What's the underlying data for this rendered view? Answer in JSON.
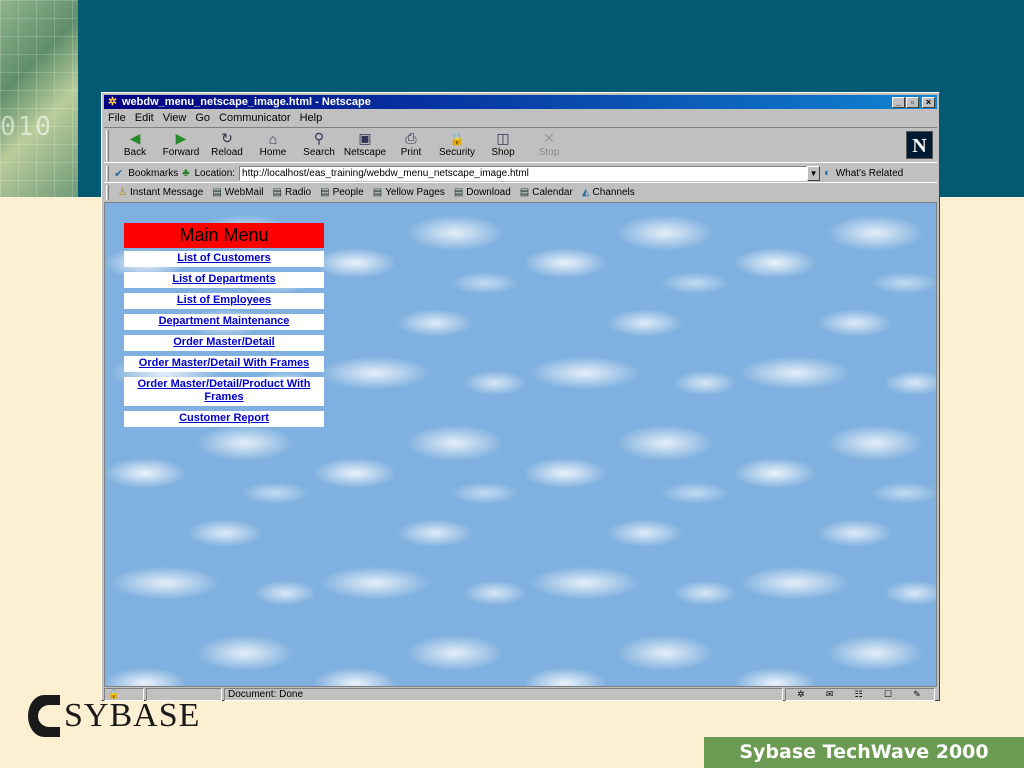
{
  "window": {
    "title": "webdw_menu_netscape_image.html - Netscape",
    "controls": {
      "minimize": "_",
      "maximize": "▫",
      "close": "×"
    }
  },
  "menubar": [
    "File",
    "Edit",
    "View",
    "Go",
    "Communicator",
    "Help"
  ],
  "navigation_toolbar": [
    {
      "label": "Back",
      "icon": "back-arrow-icon",
      "glyph": "◀",
      "enabled": true
    },
    {
      "label": "Forward",
      "icon": "forward-arrow-icon",
      "glyph": "▶",
      "enabled": true
    },
    {
      "label": "Reload",
      "icon": "reload-icon",
      "glyph": "↻",
      "enabled": true
    },
    {
      "label": "Home",
      "icon": "home-icon",
      "glyph": "⌂",
      "enabled": true
    },
    {
      "label": "Search",
      "icon": "search-icon",
      "glyph": "⚲",
      "enabled": true
    },
    {
      "label": "Netscape",
      "icon": "netscape-icon",
      "glyph": "▣",
      "enabled": true
    },
    {
      "label": "Print",
      "icon": "print-icon",
      "glyph": "⎙",
      "enabled": true
    },
    {
      "label": "Security",
      "icon": "lock-icon",
      "glyph": "🔒",
      "enabled": true
    },
    {
      "label": "Shop",
      "icon": "shop-icon",
      "glyph": "◫",
      "enabled": true
    },
    {
      "label": "Stop",
      "icon": "stop-icon",
      "glyph": "✕",
      "enabled": false
    }
  ],
  "netscape_logo": "N",
  "location_bar": {
    "bookmarks_label": "Bookmarks",
    "location_label": "Location:",
    "url": "http://localhost/eas_training/webdw_menu_netscape_image.html",
    "whats_related": "What's Related"
  },
  "personal_toolbar": [
    {
      "label": "Instant Message",
      "icon": "instant-message-icon"
    },
    {
      "label": "WebMail",
      "icon": "bookmark-page-icon"
    },
    {
      "label": "Radio",
      "icon": "bookmark-page-icon"
    },
    {
      "label": "People",
      "icon": "bookmark-page-icon"
    },
    {
      "label": "Yellow Pages",
      "icon": "bookmark-page-icon"
    },
    {
      "label": "Download",
      "icon": "bookmark-page-icon"
    },
    {
      "label": "Calendar",
      "icon": "bookmark-page-icon"
    },
    {
      "label": "Channels",
      "icon": "channels-icon"
    }
  ],
  "page": {
    "menu_title": "Main Menu",
    "menu_items": [
      "List of Customers",
      "List of Departments",
      "List of Employees",
      "Department Maintenance",
      "Order Master/Detail",
      "Order Master/Detail With Frames",
      "Order Master/Detail/Product With Frames",
      "Customer Report"
    ]
  },
  "statusbar": {
    "status": "Document: Done"
  },
  "slide": {
    "logo_text": "SYBASE",
    "footer_banner": "Sybase TechWave 2000",
    "corner_digits": "010"
  },
  "colors": {
    "slide_top": "#045a73",
    "slide_bg": "#fdf0d2",
    "menu_header": "#ff0000",
    "link": "#0000cc",
    "banner": "#6b9a52"
  }
}
